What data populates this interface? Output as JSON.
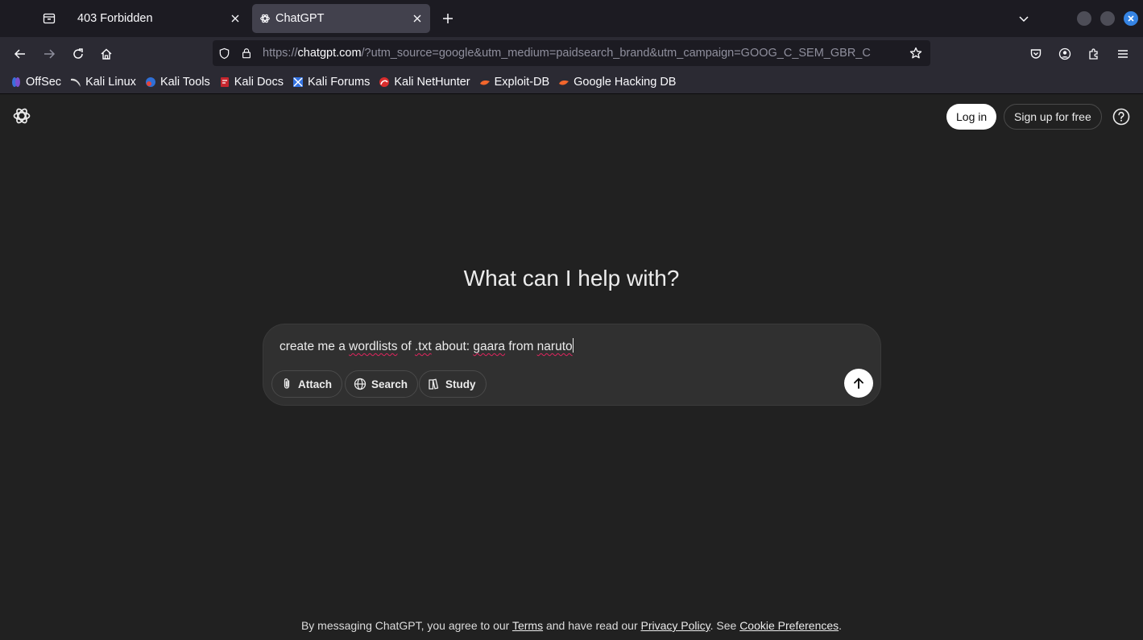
{
  "browser": {
    "tabs": [
      {
        "title": "403 Forbidden",
        "active": false
      },
      {
        "title": "ChatGPT",
        "active": true
      }
    ],
    "url": {
      "scheme": "https://",
      "host": "chatgpt.com",
      "rest": "/?utm_source=google&utm_medium=paidsearch_brand&utm_campaign=GOOG_C_SEM_GBR_C"
    },
    "bookmarks": [
      {
        "label": "OffSec",
        "icon": "offsec-icon"
      },
      {
        "label": "Kali Linux",
        "icon": "kali-dragon-icon"
      },
      {
        "label": "Kali Tools",
        "icon": "kali-tools-icon"
      },
      {
        "label": "Kali Docs",
        "icon": "kali-docs-icon"
      },
      {
        "label": "Kali Forums",
        "icon": "kali-forums-icon"
      },
      {
        "label": "Kali NetHunter",
        "icon": "nethunter-icon"
      },
      {
        "label": "Exploit-DB",
        "icon": "exploitdb-icon"
      },
      {
        "label": "Google Hacking DB",
        "icon": "ghdb-icon"
      }
    ],
    "colors": {
      "tabbar": "#1c1b22",
      "toolbar": "#2b2a33",
      "active_tab": "#42414d",
      "close_accent": "#3584e4"
    }
  },
  "header": {
    "login_label": "Log in",
    "signup_label": "Sign up for free"
  },
  "main": {
    "headline": "What can I help with?",
    "composer": {
      "text_parts": [
        "create me a ",
        "wordlists",
        " of ",
        ".txt",
        " about: ",
        "gaara",
        " from ",
        "naruto"
      ],
      "attach_label": "Attach",
      "search_label": "Search",
      "study_label": "Study"
    }
  },
  "footer": {
    "prefix": "By messaging ChatGPT, you agree to our ",
    "terms": "Terms",
    "middle": " and have read our ",
    "privacy": "Privacy Policy",
    "see": ". See ",
    "cookies": "Cookie Preferences",
    "suffix": "."
  },
  "theme": {
    "page_bg": "#212121",
    "composer_bg": "#303030",
    "text": "#ececec",
    "spell_error": "#e0245e"
  }
}
